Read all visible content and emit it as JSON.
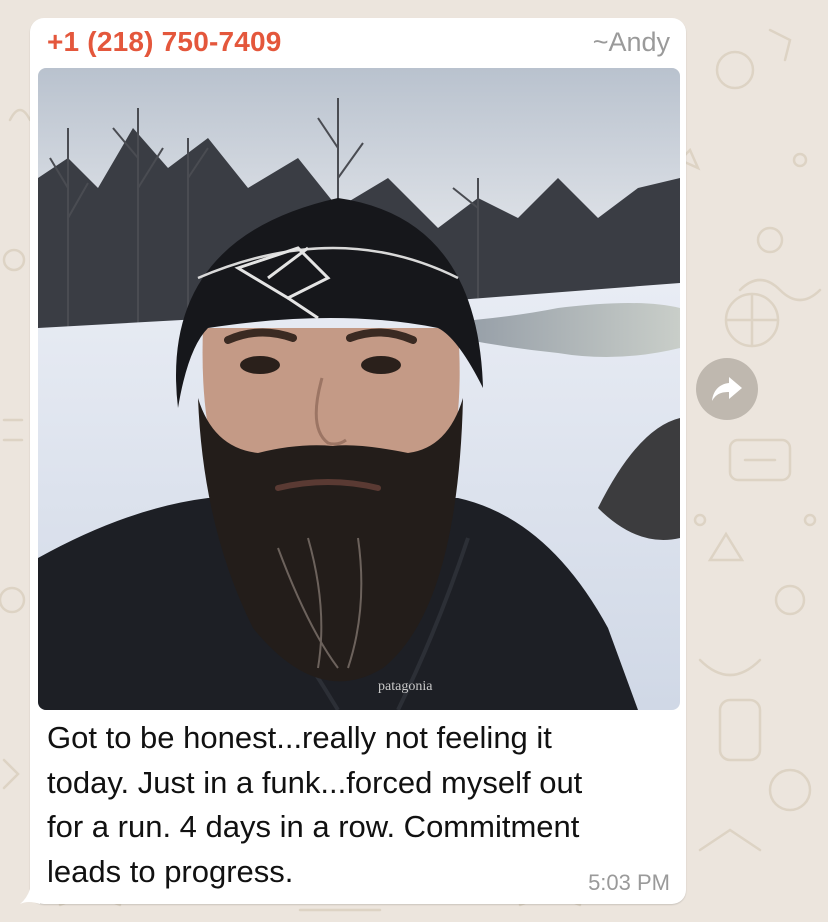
{
  "message": {
    "sender_phone": "+1 (218) 750-7409",
    "sender_push_name": "~Andy",
    "image_alt": "selfie of bearded man in beanie on snowy riverbank",
    "jacket_logo_text": "patagonia",
    "caption": "Got to be honest...really not feeling it\ntoday.  Just in a funk...forced myself out\nfor a run.  4 days in a row.  Commitment\nleads to progress.",
    "time": "5:03 PM"
  },
  "actions": {
    "forward_icon": "forward-arrow-icon"
  },
  "colors": {
    "chat_background": "#ECE5DD",
    "bubble": "#FFFFFF",
    "sender_name": "#E4573C",
    "meta_text": "#9A9A9A"
  }
}
